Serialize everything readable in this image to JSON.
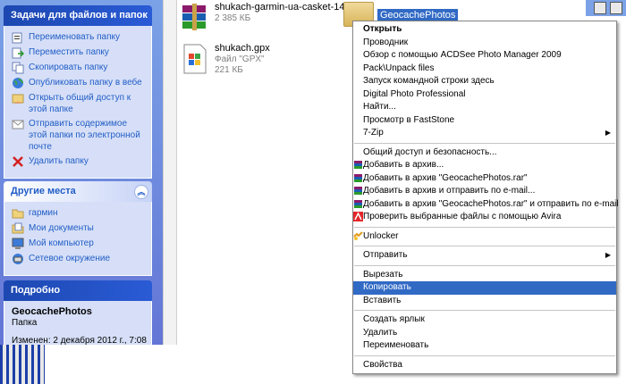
{
  "tasks_panel": {
    "title": "Задачи для файлов и папок",
    "items": [
      {
        "label": "Переименовать папку",
        "icon": "rename-icon"
      },
      {
        "label": "Переместить папку",
        "icon": "move-icon"
      },
      {
        "label": "Скопировать папку",
        "icon": "copy-icon"
      },
      {
        "label": "Опубликовать папку в вебе",
        "icon": "web-icon"
      },
      {
        "label": "Открыть общий доступ к этой папке",
        "icon": "share-icon"
      },
      {
        "label": "Отправить содержимое этой папки по электронной почте",
        "icon": "mail-icon"
      },
      {
        "label": "Удалить папку",
        "icon": "delete-icon"
      }
    ]
  },
  "places_panel": {
    "title": "Другие места",
    "items": [
      {
        "label": "гармин",
        "icon": "folder-icon"
      },
      {
        "label": "Мои документы",
        "icon": "documents-icon"
      },
      {
        "label": "Мой компьютер",
        "icon": "computer-icon"
      },
      {
        "label": "Сетевое окружение",
        "icon": "network-icon"
      }
    ]
  },
  "details_panel": {
    "title": "Подробно",
    "name": "GeocachePhotos",
    "type": "Папка",
    "modified": "Изменен: 2 декабря 2012 г., 7:08"
  },
  "files": [
    {
      "name": "shukach-garmin-ua-casket-14....",
      "meta": "2 385 КБ",
      "icon": "winrar-archive-icon"
    },
    {
      "name": "shukach.gpx",
      "meta": "Файл \"GPX\"",
      "size": "221 КБ",
      "icon": "gpx-file-icon"
    }
  ],
  "selected_folder": {
    "name": "GeocachePhotos",
    "icon": "folder-icon"
  },
  "context_menu": {
    "groups": [
      [
        {
          "label": "Открыть",
          "bold": true
        },
        {
          "label": "Проводник"
        },
        {
          "label": "Обзор с помощью ACDSee Photo Manager 2009"
        },
        {
          "label": "Pack\\Unpack files"
        },
        {
          "label": "Запуск командной строки здесь"
        },
        {
          "label": "Digital Photo Professional"
        },
        {
          "label": "Найти..."
        },
        {
          "label": "Просмотр в FastStone"
        },
        {
          "label": "7-Zip",
          "submenu": true
        }
      ],
      [
        {
          "label": "Общий доступ и безопасность..."
        },
        {
          "label": "Добавить в архив...",
          "icon": "winrar-icon"
        },
        {
          "label": "Добавить в архив \"GeocachePhotos.rar\"",
          "icon": "winrar-icon"
        },
        {
          "label": "Добавить в архив и отправить по e-mail...",
          "icon": "winrar-icon"
        },
        {
          "label": "Добавить в архив \"GeocachePhotos.rar\" и отправить по e-mail",
          "icon": "winrar-icon"
        },
        {
          "label": "Проверить выбранные файлы с помощью Avira",
          "icon": "avira-icon"
        }
      ],
      [
        {
          "label": "Unlocker",
          "icon": "unlocker-icon"
        }
      ],
      [
        {
          "label": "Отправить",
          "submenu": true
        }
      ],
      [
        {
          "label": "Вырезать"
        },
        {
          "label": "Копировать",
          "highlighted": true
        },
        {
          "label": "Вставить"
        }
      ],
      [
        {
          "label": "Создать ярлык"
        },
        {
          "label": "Удалить"
        },
        {
          "label": "Переименовать"
        }
      ],
      [
        {
          "label": "Свойства"
        }
      ]
    ]
  },
  "colors": {
    "pane_gradient_top": "#7ba2e7",
    "pane_gradient_bottom": "#6375d6",
    "link_blue": "#215dc6",
    "selection": "#316ac5"
  }
}
